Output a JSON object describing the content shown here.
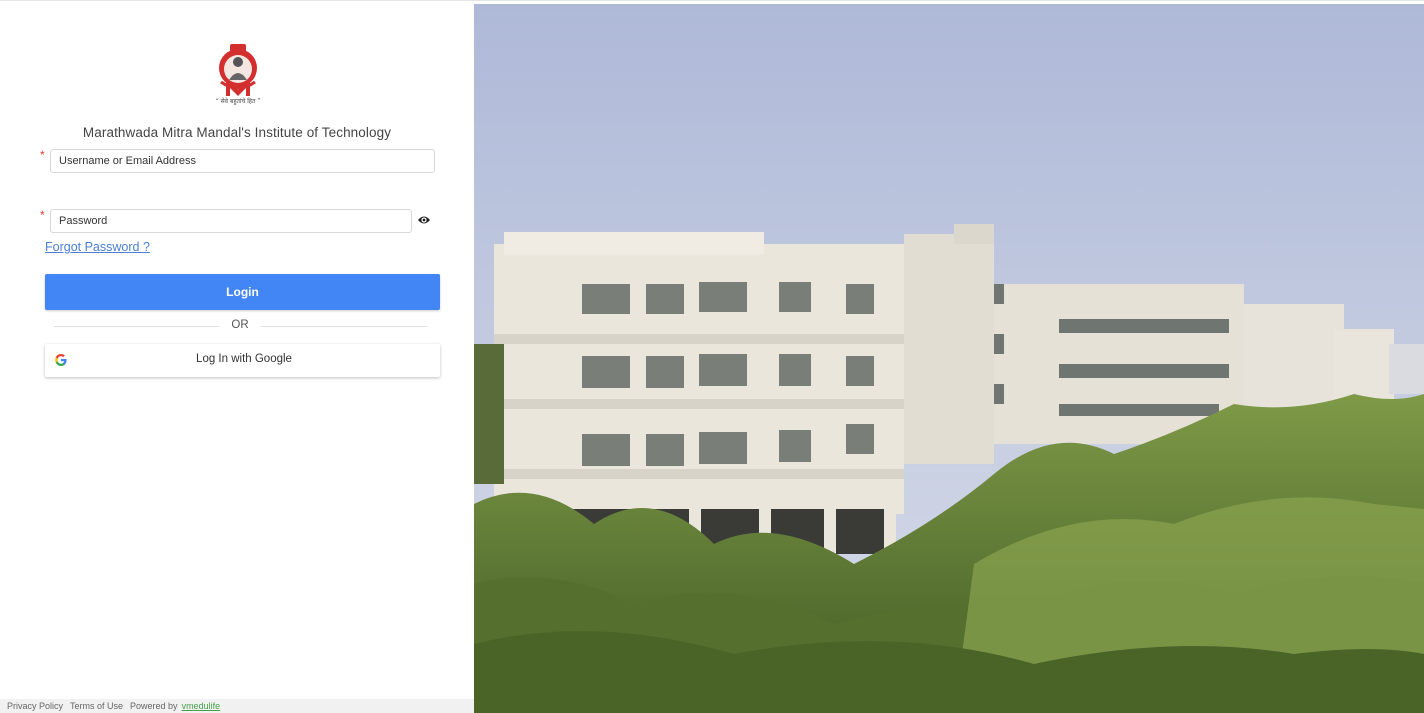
{
  "logo": {
    "icon": "mmm-seal-icon",
    "caption": "“ सेवे बहुतांचे हित ”",
    "letter": "M"
  },
  "institute_name": "Marathwada Mitra Mandal's Institute of Technology",
  "login_form": {
    "username_placeholder": "Username or Email Address",
    "password_placeholder": "Password",
    "required_marker": "*",
    "show_password_icon": "eye-icon",
    "forgot_password": "Forgot Password ?",
    "login_button": "Login",
    "divider": "OR",
    "google_button": "Log In with Google",
    "google_icon": "google-icon"
  },
  "footer": {
    "privacy": "Privacy Policy",
    "terms": "Terms of Use",
    "powered_by": "Powered by",
    "brand": "vmedulife"
  },
  "colors": {
    "primary": "#4285f4",
    "link": "#4a7fd4",
    "required": "#e53935",
    "logo_red": "#d32f2f",
    "brand_green": "#46a14a"
  },
  "hero_image": {
    "subject": "campus-building-photo"
  }
}
